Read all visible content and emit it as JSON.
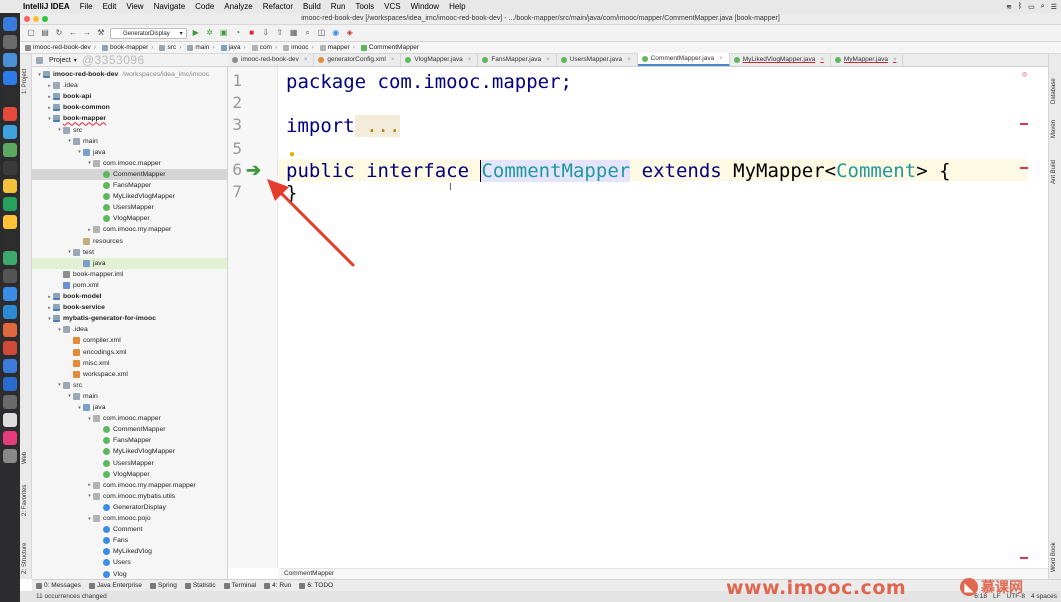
{
  "menubar": {
    "apple_glyph": "",
    "app": "IntelliJ IDEA",
    "items": [
      "File",
      "Edit",
      "View",
      "Navigate",
      "Code",
      "Analyze",
      "Refactor",
      "Build",
      "Run",
      "Tools",
      "VCS",
      "Window",
      "Help"
    ]
  },
  "window": {
    "title": "imooc-red-book-dev [/workspaces/idea_imc/imooc-red-book-dev] - .../book-mapper/src/main/java/com/imooc/mapper/CommentMapper.java [book-mapper]"
  },
  "toolbar": {
    "run_config": "GeneratorDisplay"
  },
  "breadcrumb": [
    "imooc-red-book-dev",
    "book-mapper",
    "src",
    "main",
    "java",
    "com",
    "imooc",
    "mapper",
    "CommentMapper"
  ],
  "project_panel": {
    "title": "Project",
    "watermark": "@3353096"
  },
  "tree": [
    {
      "depth": 0,
      "arrow": "▾",
      "icon": "f-mod",
      "label": "imooc-red-book-dev",
      "bold": true,
      "extra": "/workspaces/idea_imc/imooc"
    },
    {
      "depth": 1,
      "arrow": "▸",
      "icon": "f-folder",
      "label": ".idea"
    },
    {
      "depth": 1,
      "arrow": "▸",
      "icon": "f-mod",
      "label": "book-api",
      "bold": true
    },
    {
      "depth": 1,
      "arrow": "▸",
      "icon": "f-mod",
      "label": "book-common",
      "bold": true
    },
    {
      "depth": 1,
      "arrow": "▾",
      "icon": "f-mod",
      "label": "book-mapper",
      "bold": true,
      "red": true
    },
    {
      "depth": 2,
      "arrow": "▾",
      "icon": "f-folder",
      "label": "src"
    },
    {
      "depth": 3,
      "arrow": "▾",
      "icon": "f-folder",
      "label": "main"
    },
    {
      "depth": 4,
      "arrow": "▾",
      "icon": "f-src",
      "label": "java"
    },
    {
      "depth": 5,
      "arrow": "▾",
      "icon": "f-pkg",
      "label": "com.imooc.mapper"
    },
    {
      "depth": 6,
      "arrow": "",
      "icon": "f-int",
      "label": "CommentMapper",
      "sel": true
    },
    {
      "depth": 6,
      "arrow": "",
      "icon": "f-int",
      "label": "FansMapper"
    },
    {
      "depth": 6,
      "arrow": "",
      "icon": "f-int",
      "label": "MyLikedVlogMapper"
    },
    {
      "depth": 6,
      "arrow": "",
      "icon": "f-int",
      "label": "UsersMapper"
    },
    {
      "depth": 6,
      "arrow": "",
      "icon": "f-int",
      "label": "VlogMapper"
    },
    {
      "depth": 5,
      "arrow": "▸",
      "icon": "f-pkg",
      "label": "com.imooc.my.mapper"
    },
    {
      "depth": 4,
      "arrow": "",
      "icon": "f-res",
      "label": "resources"
    },
    {
      "depth": 3,
      "arrow": "▾",
      "icon": "f-folder",
      "label": "test"
    },
    {
      "depth": 4,
      "arrow": "",
      "icon": "f-src",
      "label": "java",
      "hl": true
    },
    {
      "depth": 2,
      "arrow": "",
      "icon": "f-iml",
      "label": "book-mapper.iml"
    },
    {
      "depth": 2,
      "arrow": "",
      "icon": "f-pom",
      "label": "pom.xml"
    },
    {
      "depth": 1,
      "arrow": "▸",
      "icon": "f-mod",
      "label": "book-model",
      "bold": true
    },
    {
      "depth": 1,
      "arrow": "▸",
      "icon": "f-mod",
      "label": "book-service",
      "bold": true
    },
    {
      "depth": 1,
      "arrow": "▾",
      "icon": "f-mod",
      "label": "mybatis-generator-for-imooc",
      "bold": true
    },
    {
      "depth": 2,
      "arrow": "▾",
      "icon": "f-folder",
      "label": ".idea"
    },
    {
      "depth": 3,
      "arrow": "",
      "icon": "f-xml",
      "label": "compiler.xml"
    },
    {
      "depth": 3,
      "arrow": "",
      "icon": "f-xml",
      "label": "encodings.xml"
    },
    {
      "depth": 3,
      "arrow": "",
      "icon": "f-xml",
      "label": "misc.xml"
    },
    {
      "depth": 3,
      "arrow": "",
      "icon": "f-xml",
      "label": "workspace.xml"
    },
    {
      "depth": 2,
      "arrow": "▾",
      "icon": "f-folder",
      "label": "src"
    },
    {
      "depth": 3,
      "arrow": "▾",
      "icon": "f-folder",
      "label": "main"
    },
    {
      "depth": 4,
      "arrow": "▾",
      "icon": "f-src",
      "label": "java"
    },
    {
      "depth": 5,
      "arrow": "▾",
      "icon": "f-pkg",
      "label": "com.imooc.mapper"
    },
    {
      "depth": 6,
      "arrow": "",
      "icon": "f-int",
      "label": "CommentMapper"
    },
    {
      "depth": 6,
      "arrow": "",
      "icon": "f-int",
      "label": "FansMapper"
    },
    {
      "depth": 6,
      "arrow": "",
      "icon": "f-int",
      "label": "MyLikedVlogMapper"
    },
    {
      "depth": 6,
      "arrow": "",
      "icon": "f-int",
      "label": "UsersMapper"
    },
    {
      "depth": 6,
      "arrow": "",
      "icon": "f-int",
      "label": "VlogMapper"
    },
    {
      "depth": 5,
      "arrow": "▸",
      "icon": "f-pkg",
      "label": "com.imooc.my.mapper.mapper"
    },
    {
      "depth": 5,
      "arrow": "▾",
      "icon": "f-pkg",
      "label": "com.imooc.mybatis.utils"
    },
    {
      "depth": 6,
      "arrow": "",
      "icon": "f-cls",
      "label": "GeneratorDisplay"
    },
    {
      "depth": 5,
      "arrow": "▾",
      "icon": "f-pkg",
      "label": "com.imooc.pojo"
    },
    {
      "depth": 6,
      "arrow": "",
      "icon": "f-cls",
      "label": "Comment"
    },
    {
      "depth": 6,
      "arrow": "",
      "icon": "f-cls",
      "label": "Fans"
    },
    {
      "depth": 6,
      "arrow": "",
      "icon": "f-cls",
      "label": "MyLikedVlog"
    },
    {
      "depth": 6,
      "arrow": "",
      "icon": "f-cls",
      "label": "Users"
    },
    {
      "depth": 6,
      "arrow": "",
      "icon": "f-cls",
      "label": "Vlog"
    }
  ],
  "tabs": [
    {
      "label": "imooc-red-book-dev",
      "color": "#8c8c8c"
    },
    {
      "label": "generatorConfig.xml",
      "color": "#e48a38"
    },
    {
      "label": "VlogMapper.java",
      "color": "#5fb75b"
    },
    {
      "label": "FansMapper.java",
      "color": "#5fb75b"
    },
    {
      "label": "UsersMapper.java",
      "color": "#5fb75b"
    },
    {
      "label": "CommentMapper.java",
      "color": "#5fb75b",
      "active": true
    },
    {
      "label": "MyLikedVlogMapper.java",
      "color": "#5fb75b",
      "mod": true
    },
    {
      "label": "MyMapper.java",
      "color": "#5fb75b",
      "mod": true
    }
  ],
  "editor": {
    "line_numbers": [
      "1",
      "2",
      "3",
      "5",
      "6",
      "7"
    ],
    "line1_kw": "package",
    "line1_rest": " com.imooc.mapper;",
    "line3_kw": "import",
    "line3_fold": " ...",
    "line6_kw1": "public",
    "line6_kw2": " interface ",
    "line6_name": "CommentMapper",
    "line6_kw3": " extends ",
    "line6_super": "MyMapper<",
    "line6_gen": "Comment",
    "line6_end": "> {",
    "line7": "}",
    "footer": "CommentMapper"
  },
  "left_strip": {
    "project": "1: Project",
    "web": "Web",
    "favorites": "2: Favorites",
    "structure": "Z: Structure"
  },
  "right_strip": {
    "database": "Database",
    "maven": "Maven",
    "ant": "Ant Build",
    "word": "Word Book"
  },
  "bottom_tools": [
    "0: Messages",
    "Java Enterprise",
    "Spring",
    "Statistic",
    "Terminal",
    "4: Run",
    "6: TODO"
  ],
  "status": {
    "left": "11 occurrences changed",
    "right": [
      "6:18",
      "LF",
      "UTF-8",
      "4 spaces"
    ]
  },
  "watermark_text": "www.imooc.com",
  "brand": "慕课网"
}
